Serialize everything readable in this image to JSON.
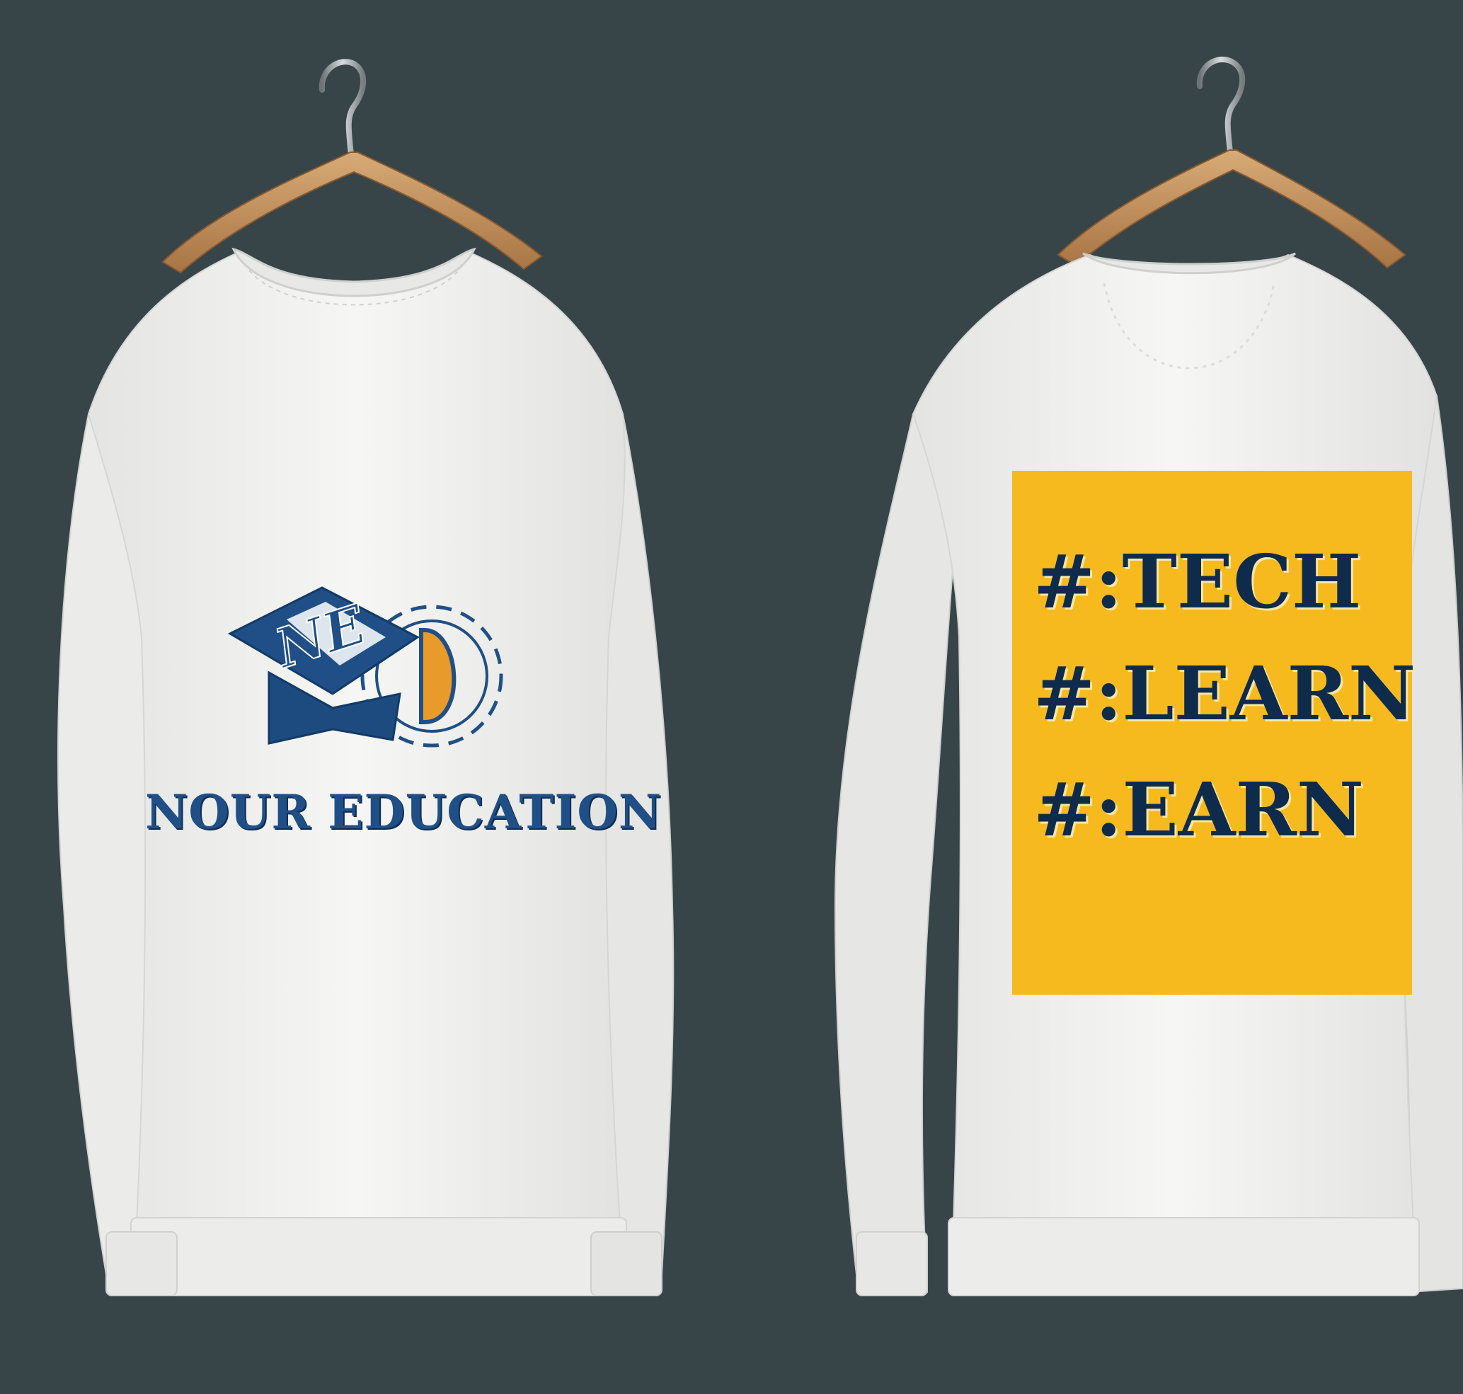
{
  "colors": {
    "background": "#374548",
    "sweatshirt": "#f2f2f0",
    "logo_blue": "#1f4f86",
    "logo_orange": "#e89a2a",
    "print_yellow": "#f6b91e",
    "print_text": "#0f2b4c"
  },
  "front": {
    "logo_monogram": "NE D",
    "brand_name": "NOUR EDUCATION"
  },
  "back": {
    "tags": [
      "#:TECH",
      "#:LEARN",
      "#:EARN"
    ]
  }
}
